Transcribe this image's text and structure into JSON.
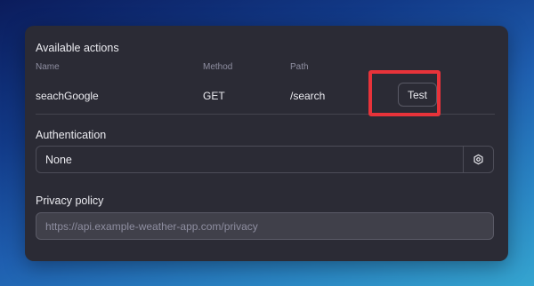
{
  "available_actions": {
    "title": "Available actions",
    "columns": {
      "name": "Name",
      "method": "Method",
      "path": "Path"
    },
    "rows": [
      {
        "name": "seachGoogle",
        "method": "GET",
        "path": "/search",
        "button_label": "Test"
      }
    ]
  },
  "authentication": {
    "title": "Authentication",
    "value": "None",
    "settings_icon": "gear-icon"
  },
  "privacy": {
    "title": "Privacy policy",
    "placeholder": "https://api.example-weather-app.com/privacy",
    "value": ""
  },
  "colors": {
    "panel_bg": "#2b2b35",
    "highlight": "#e8333a",
    "text": "#ececf1",
    "muted": "#8e8ea0"
  }
}
